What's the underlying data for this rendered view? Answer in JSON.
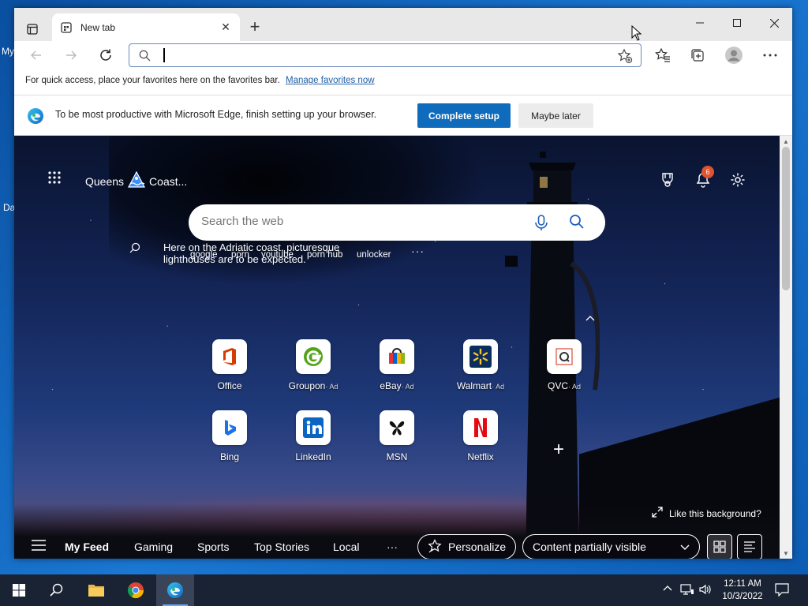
{
  "desktop": {
    "labels": [
      "My",
      "Da"
    ]
  },
  "browser": {
    "tab": {
      "title": "New tab"
    },
    "address": {
      "placeholder": "",
      "value": ""
    },
    "favorites_bar": {
      "message": "For quick access, place your favorites here on the favorites bar.",
      "link": "Manage favorites now"
    },
    "setup_banner": {
      "message": "To be most productive with Microsoft Edge, finish setting up your browser.",
      "primary_label": "Complete setup",
      "secondary_label": "Maybe later"
    }
  },
  "newtab": {
    "location": "Queens",
    "weather": "Coast...",
    "notification_count": "6",
    "search_placeholder": "Search the web",
    "trending": [
      "google",
      "porn",
      "youtube",
      "porn hub",
      "unlocker"
    ],
    "bg_info": "Here on the Adriatic coast, picturesque lighthouses are to be expected.",
    "more": "···",
    "tiles_row1": [
      {
        "name": "Office",
        "ad": ""
      },
      {
        "name": "Groupon",
        "ad": "· Ad"
      },
      {
        "name": "eBay",
        "ad": "· Ad"
      },
      {
        "name": "Walmart",
        "ad": "· Ad"
      },
      {
        "name": "QVC",
        "ad": "· Ad"
      }
    ],
    "tiles_row2": [
      {
        "name": "Bing",
        "ad": ""
      },
      {
        "name": "LinkedIn",
        "ad": ""
      },
      {
        "name": "MSN",
        "ad": ""
      },
      {
        "name": "Netflix",
        "ad": ""
      }
    ],
    "like_bg": "Like this background?",
    "feed": {
      "items": [
        "My Feed",
        "Gaming",
        "Sports",
        "Top Stories",
        "Local"
      ],
      "more": "···",
      "personalize": "Personalize",
      "visibility": "Content partially visible"
    }
  },
  "taskbar": {
    "time": "12:11 AM",
    "date": "10/3/2022"
  },
  "colors": {
    "accent": "#0f6cbd",
    "badge": "#e0532e",
    "taskbar": "#1a2333"
  }
}
